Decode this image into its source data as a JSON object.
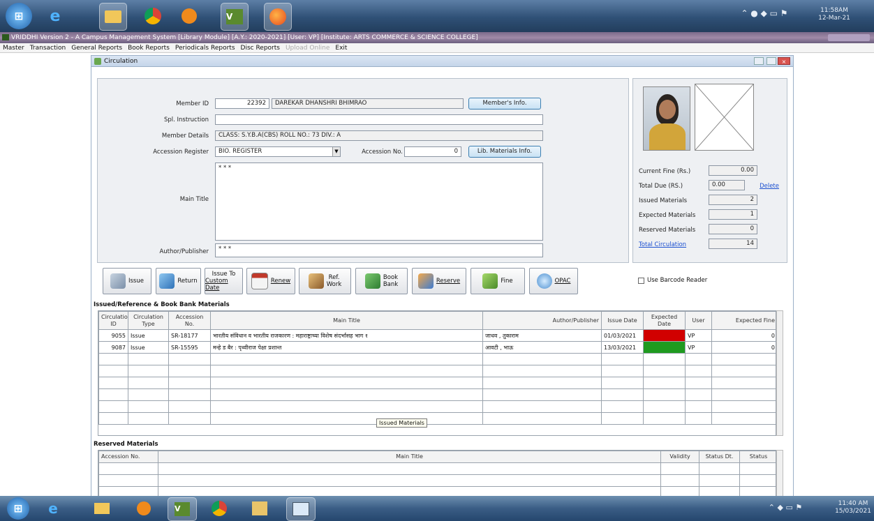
{
  "taskbar_top": {
    "clock_time": "11:58AM",
    "clock_date": "12-Mar-21"
  },
  "window": {
    "title": "VRIDDHI Version 2 - A Campus Management System [Library Module] [A.Y.: 2020-2021] [User: VP] [Institute: ARTS COMMERCE & SCIENCE COLLEGE]"
  },
  "menu": {
    "items": [
      "Master",
      "Transaction",
      "General Reports",
      "Book Reports",
      "Periodicals Reports",
      "Disc Reports",
      "Upload Online",
      "Exit"
    ]
  },
  "circulation": {
    "title": "Circulation",
    "member_id_label": "Member ID",
    "member_id": "22392",
    "member_name": "DAREKAR DHANSHRI BHIMRAO",
    "members_info_btn": "Member's Info.",
    "spl_instruction_label": "Spl. Instruction",
    "spl_instruction": "",
    "member_details_label": "Member Details",
    "member_details": "CLASS: S.Y.B.A(CBS)  ROLL NO.: 73  DIV.: A",
    "accession_register_label": "Accession Register",
    "accession_register": "BIO. REGISTER",
    "accession_no_label": "Accession No.",
    "accession_no": "0",
    "lib_materials_btn": "Lib. Materials Info.",
    "main_title_label": "Main Title",
    "main_title": "* * *",
    "author_publisher_label": "Author/Publisher",
    "author_publisher": "* * *"
  },
  "summary": {
    "current_fine_label": "Current Fine (Rs.)",
    "current_fine": "0.00",
    "total_due_label": "Total Due (RS.)",
    "total_due": "0.00",
    "delete_link": "Delete",
    "issued_label": "Issued Materials",
    "issued": "2",
    "expected_label": "Expected Materials",
    "expected": "1",
    "reserved_label": "Reserved Materials",
    "reserved": "0",
    "total_circ_label": "Total Circulation",
    "total_circ": "14"
  },
  "actions": {
    "issue": "Issue",
    "return": "Return",
    "issue_custom_1": "Issue To",
    "issue_custom_2": "Custom Date",
    "renew": "Renew",
    "ref_work_1": "Ref.",
    "ref_work_2": "Work",
    "book_bank_1": "Book",
    "book_bank_2": "Bank",
    "reserve": "Reserve",
    "fine": "Fine",
    "opac": "OPAC",
    "barcode": "Use Barcode Reader"
  },
  "issued_grid": {
    "caption": "Issued/Reference & Book Bank Materials",
    "headers": [
      "Circulation ID",
      "Circulation Type",
      "Accession No.",
      "Main Title",
      "Author/Publisher",
      "Issue Date",
      "Expected Date",
      "User",
      "Expected Fine"
    ],
    "rows": [
      {
        "id": "9055",
        "type": "Issue",
        "acc": "SR-18177",
        "title": "भारतीय संविधान व भारतीय राजकारण : महाराष्ट्राच्या विशेष संदर्भासह भाग १",
        "author": "जाधव , तुकाराम",
        "issue_date": "01/03/2021",
        "user": "VP",
        "fine": "0"
      },
      {
        "id": "9087",
        "type": "Issue",
        "acc": "SR-15595",
        "title": "मन्हे ड बैर : पृथ्वीराज पेक्षा प्रशान्त",
        "author": "आवटी , भाऊ",
        "issue_date": "13/03/2021",
        "user": "VP",
        "fine": "0"
      }
    ],
    "tooltip": "Issued Materials"
  },
  "reserved_grid": {
    "caption": "Reserved Materials",
    "headers": [
      "Accession No.",
      "Main Title",
      "Validity",
      "Status Dt.",
      "Status"
    ]
  },
  "taskbar_bottom": {
    "clock_time": "11:40 AM",
    "clock_date": "15/03/2021"
  },
  "colors": {
    "overdue": "#d10000",
    "ok": "#1f9a1f"
  }
}
